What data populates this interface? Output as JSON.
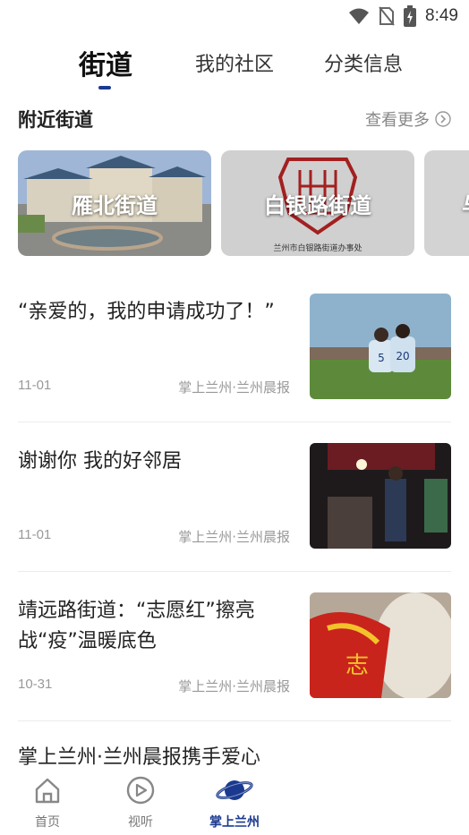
{
  "status": {
    "time": "8:49"
  },
  "tabs": [
    {
      "label": "街道"
    },
    {
      "label": "我的社区"
    },
    {
      "label": "分类信息"
    }
  ],
  "nearby": {
    "title": "附近街道",
    "see_more": "查看更多",
    "cards": [
      {
        "label": "雁北街道"
      },
      {
        "label": "白银路街道",
        "sublabel": "兰州市白银路街道办事处"
      },
      {
        "label": "与"
      }
    ]
  },
  "news": [
    {
      "title": "“亲爱的，我的申请成功了！”",
      "date": "11-01",
      "source": "掌上兰州·兰州晨报",
      "image": "couple-photo"
    },
    {
      "title": "谢谢你 我的好邻居",
      "date": "11-01",
      "source": "掌上兰州·兰州晨报",
      "image": "night-street-photo"
    },
    {
      "title": "靖远路街道：“志愿红”擦亮战“疫”温暖底色",
      "date": "10-31",
      "source": "掌上兰州·兰州晨报",
      "image": "volunteer-armband-photo"
    },
    {
      "title": "掌上兰州·兰州晨报携手爱心"
    }
  ],
  "bottom_nav": [
    {
      "label": "首页",
      "icon": "home-icon"
    },
    {
      "label": "视听",
      "icon": "play-icon"
    },
    {
      "label": "掌上兰州",
      "icon": "planet-icon"
    }
  ],
  "colors": {
    "accent": "#1b3a8f"
  }
}
